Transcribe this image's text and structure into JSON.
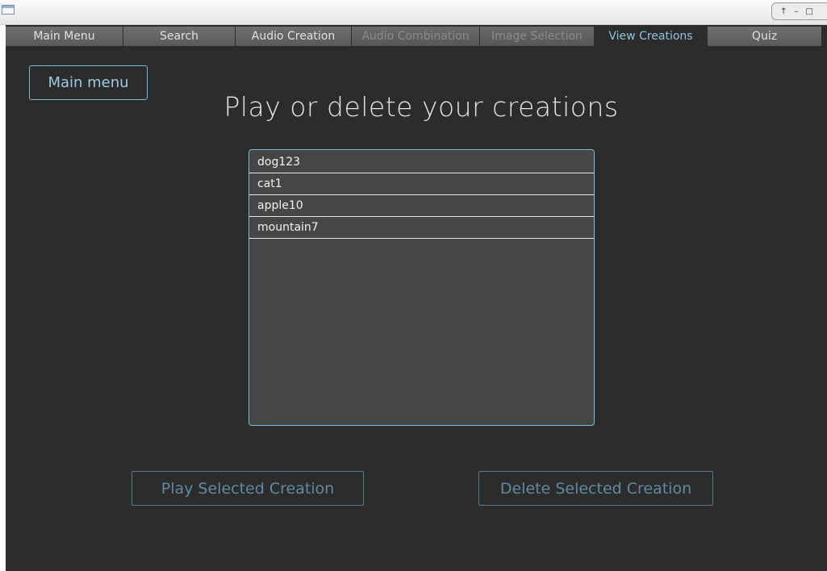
{
  "window": {
    "controls": [
      "↑",
      "–",
      "□"
    ]
  },
  "tabs": [
    {
      "label": "Main Menu",
      "state": "normal"
    },
    {
      "label": "Search",
      "state": "normal"
    },
    {
      "label": "Audio Creation",
      "state": "normal"
    },
    {
      "label": "Audio Combination",
      "state": "disabled"
    },
    {
      "label": "Image Selection",
      "state": "disabled"
    },
    {
      "label": "View Creations",
      "state": "active"
    },
    {
      "label": "Quiz",
      "state": "normal"
    }
  ],
  "main_menu_button": "Main menu",
  "page_title": "Play or delete your creations",
  "creations": [
    "dog123",
    "cat1",
    "apple10",
    "mountain7"
  ],
  "actions": {
    "play": "Play Selected Creation",
    "delete": "Delete Selected Creation"
  },
  "colors": {
    "background": "#2c2c2c",
    "accent": "#7fb8d8",
    "list_background": "#464646"
  }
}
